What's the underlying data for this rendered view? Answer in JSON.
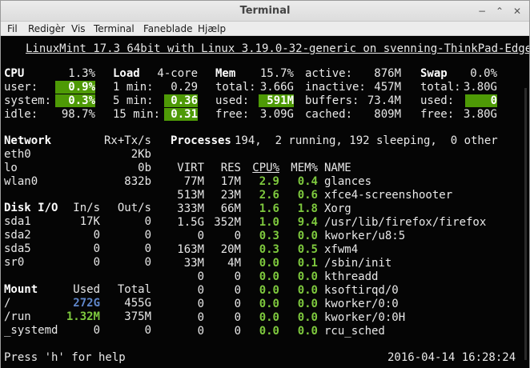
{
  "window": {
    "title": "Terminal"
  },
  "menu": [
    "Fil",
    "Redigèr",
    "Vis",
    "Terminal",
    "Faneblade",
    "Hjælp"
  ],
  "header": "LinuxMint 17.3 64bit with Linux 3.19.0-32-generic on svenning-ThinkPad-Edge",
  "cpu": {
    "title": "CPU",
    "total": "1.3%",
    "rows": [
      {
        "label": "user:",
        "value": "0.9%"
      },
      {
        "label": "system:",
        "value": "0.3%"
      },
      {
        "label": "idle:",
        "value": "98.7%"
      }
    ]
  },
  "load": {
    "title": "Load",
    "cores": "4-core",
    "rows": [
      {
        "label": "1 min:",
        "value": "0.29"
      },
      {
        "label": "5 min:",
        "value": "0.36"
      },
      {
        "label": "15 min:",
        "value": "0.31"
      }
    ]
  },
  "mem": {
    "title": "Mem",
    "pct": "15.7%",
    "rows": [
      {
        "label": "total:",
        "value": "3.66G"
      },
      {
        "label": "used:",
        "value": "591M"
      },
      {
        "label": "free:",
        "value": "3.09G"
      }
    ],
    "extra": [
      {
        "label": "active:",
        "value": "876M"
      },
      {
        "label": "inactive:",
        "value": "457M"
      },
      {
        "label": "buffers:",
        "value": "73.4M"
      },
      {
        "label": "cached:",
        "value": "809M"
      }
    ]
  },
  "swap": {
    "title": "Swap",
    "pct": "0.0%",
    "rows": [
      {
        "label": "total:",
        "value": "3.80G"
      },
      {
        "label": "used:",
        "value": "0"
      },
      {
        "label": "free:",
        "value": "3.80G"
      }
    ]
  },
  "network": {
    "title": "Network",
    "cols": "Rx+Tx/s",
    "rows": [
      {
        "iface": "eth0",
        "rate": "2Kb"
      },
      {
        "iface": "lo",
        "rate": "0b"
      },
      {
        "iface": "wlan0",
        "rate": "832b"
      }
    ]
  },
  "disk": {
    "title": "Disk I/O",
    "col_in": "In/s",
    "col_out": "Out/s",
    "rows": [
      {
        "name": "sda1",
        "in": "17K",
        "out": "0"
      },
      {
        "name": "sda2",
        "in": "0",
        "out": "0"
      },
      {
        "name": "sda5",
        "in": "0",
        "out": "0"
      },
      {
        "name": "sr0",
        "in": "0",
        "out": "0"
      }
    ]
  },
  "mount": {
    "title": "Mount",
    "col_used": "Used",
    "col_total": "Total",
    "rows": [
      {
        "name": "/",
        "used": "272G",
        "total": "455G"
      },
      {
        "name": "/run",
        "used": "1.32M",
        "total": "375M"
      },
      {
        "name": "_systemd",
        "used": "0",
        "total": "0"
      }
    ]
  },
  "processes": {
    "summary_title": "Processes",
    "summary": "194,  2 running, 192 sleeping,  0 other",
    "cols": {
      "virt": "VIRT",
      "res": "RES",
      "cpu": "CPU%",
      "mem": "MEM%",
      "name": "NAME"
    },
    "rows": [
      {
        "virt": "77M",
        "res": "17M",
        "cpu": "2.9",
        "mem": "0.4",
        "name": "glances"
      },
      {
        "virt": "513M",
        "res": "23M",
        "cpu": "2.6",
        "mem": "0.6",
        "name": "xfce4-screenshooter"
      },
      {
        "virt": "333M",
        "res": "66M",
        "cpu": "1.6",
        "mem": "1.8",
        "name": "Xorg"
      },
      {
        "virt": "1.5G",
        "res": "352M",
        "cpu": "1.0",
        "mem": "9.4",
        "name": "/usr/lib/firefox/firefox"
      },
      {
        "virt": "0",
        "res": "0",
        "cpu": "0.3",
        "mem": "0.0",
        "name": "kworker/u8:5"
      },
      {
        "virt": "163M",
        "res": "20M",
        "cpu": "0.3",
        "mem": "0.5",
        "name": "xfwm4"
      },
      {
        "virt": "33M",
        "res": "4M",
        "cpu": "0.0",
        "mem": "0.1",
        "name": "/sbin/init"
      },
      {
        "virt": "0",
        "res": "0",
        "cpu": "0.0",
        "mem": "0.0",
        "name": "kthreadd"
      },
      {
        "virt": "0",
        "res": "0",
        "cpu": "0.0",
        "mem": "0.0",
        "name": "ksoftirqd/0"
      },
      {
        "virt": "0",
        "res": "0",
        "cpu": "0.0",
        "mem": "0.0",
        "name": "kworker/0:0"
      },
      {
        "virt": "0",
        "res": "0",
        "cpu": "0.0",
        "mem": "0.0",
        "name": "kworker/0:0H"
      },
      {
        "virt": "0",
        "res": "0",
        "cpu": "0.0",
        "mem": "0.0",
        "name": "rcu_sched"
      }
    ]
  },
  "footer": {
    "help": "Press 'h' for help",
    "datetime": "2016-04-14 16:28:24"
  }
}
